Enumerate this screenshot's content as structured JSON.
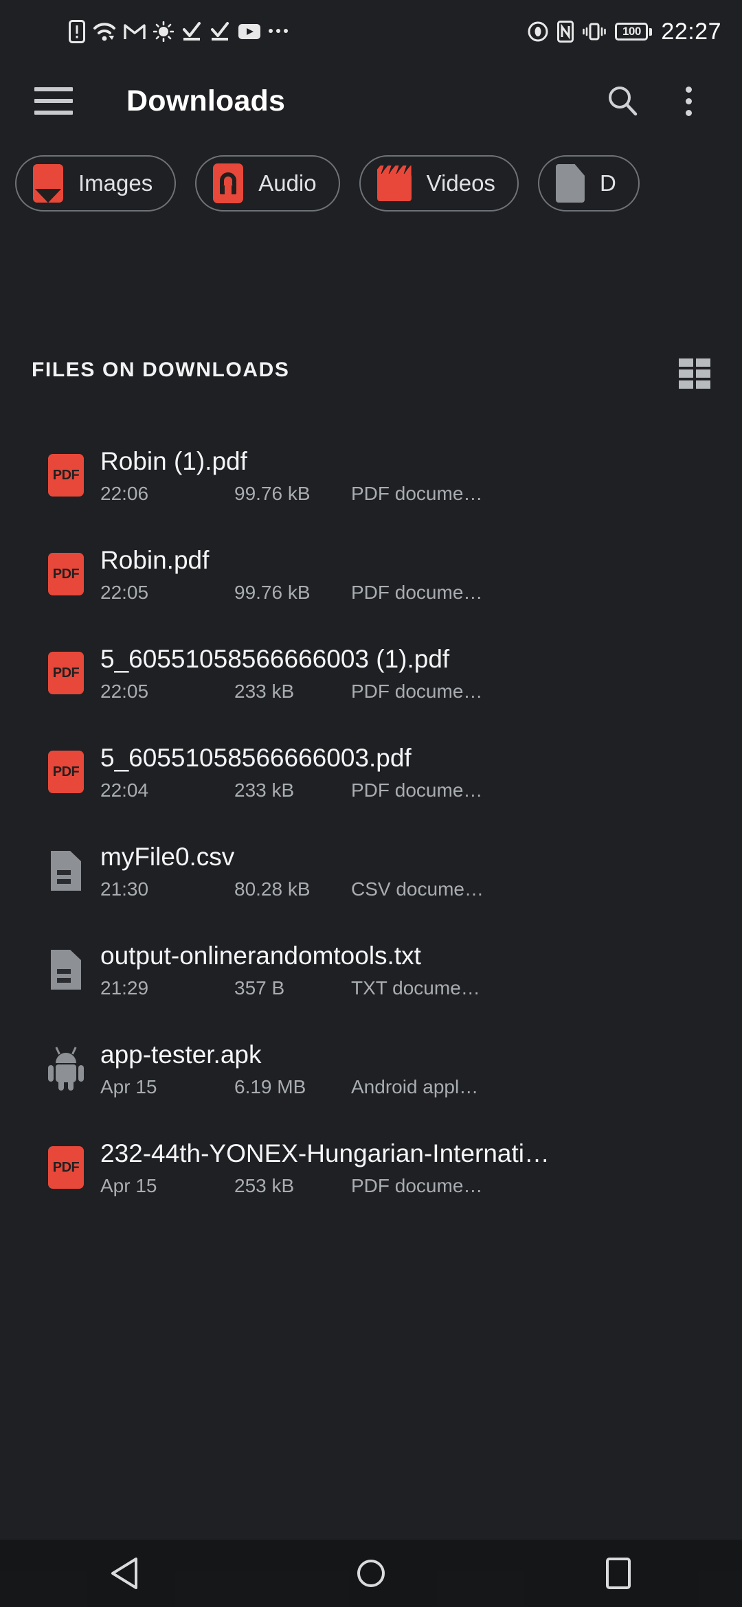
{
  "statusbar": {
    "icons_left": [
      "sim-alert-icon",
      "wifi-icon",
      "gmail-icon",
      "brightness-icon",
      "download-complete-icon",
      "download-complete-icon-2",
      "youtube-icon",
      "more-notifications-icon"
    ],
    "icons_right": [
      "eye-comfort-icon",
      "nfc-icon",
      "vibrate-icon"
    ],
    "battery_level": "100",
    "clock": "22:27"
  },
  "appbar": {
    "menu_icon": "hamburger-menu-icon",
    "title": "Downloads",
    "search_icon": "search-icon",
    "overflow_icon": "overflow-menu-icon"
  },
  "chips": [
    {
      "label": "Images",
      "icon": "image-icon",
      "color": "#e8483a"
    },
    {
      "label": "Audio",
      "icon": "audio-headphone-icon",
      "color": "#e8483a"
    },
    {
      "label": "Videos",
      "icon": "video-clapperboard-icon",
      "color": "#e8483a"
    },
    {
      "label": "D",
      "icon": "document-icon",
      "color": "#8d9094"
    }
  ],
  "section": {
    "title": "FILES ON DOWNLOADS",
    "view_toggle_icon": "grid-view-icon"
  },
  "files": [
    {
      "name": "Robin (1).pdf",
      "time": "22:06",
      "size": "99.76 kB",
      "type": "PDF docume…",
      "icon": "pdf-file-icon"
    },
    {
      "name": "Robin.pdf",
      "time": "22:05",
      "size": "99.76 kB",
      "type": "PDF docume…",
      "icon": "pdf-file-icon"
    },
    {
      "name": "5_60551058566666003 (1).pdf",
      "time": "22:05",
      "size": "233 kB",
      "type": "PDF docume…",
      "icon": "pdf-file-icon"
    },
    {
      "name": "5_60551058566666003.pdf",
      "time": "22:04",
      "size": "233 kB",
      "type": "PDF docume…",
      "icon": "pdf-file-icon"
    },
    {
      "name": "myFile0.csv",
      "time": "21:30",
      "size": "80.28 kB",
      "type": "CSV docume…",
      "icon": "generic-document-icon"
    },
    {
      "name": "output-onlinerandomtools.txt",
      "time": "21:29",
      "size": "357 B",
      "type": "TXT docume…",
      "icon": "generic-document-icon"
    },
    {
      "name": "app-tester.apk",
      "time": "Apr 15",
      "size": "6.19 MB",
      "type": "Android appl…",
      "icon": "android-apk-icon"
    },
    {
      "name": "232-44th-YONEX-Hungarian-Internati…",
      "time": "Apr 15",
      "size": "253 kB",
      "type": "PDF docume…",
      "icon": "pdf-file-icon"
    }
  ],
  "navbar": {
    "back_icon": "back-triangle-icon",
    "home_icon": "home-circle-icon",
    "recents_icon": "recents-square-icon"
  },
  "theme": {
    "background": "#1e2023",
    "accent_red": "#e8483a",
    "text_primary": "#f4f5f6",
    "text_secondary": "#a9acb0",
    "chip_border": "#6f7276"
  },
  "pdf_label": "PDF"
}
